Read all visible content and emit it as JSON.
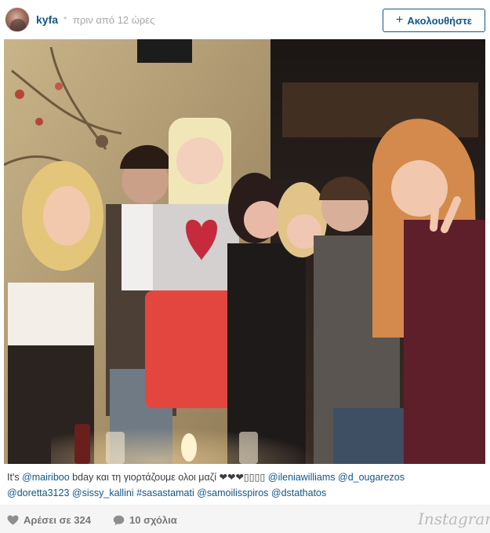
{
  "post": {
    "username": "kyfa",
    "separator": "•",
    "timestamp": "πριν από 12 ώρες",
    "follow_label": "Ακολουθήστε",
    "follow_plus": "+"
  },
  "caption": {
    "text_1": "It's ",
    "mention_1": "@mairiboo",
    "text_2": " bday και τη γιορτάζουμε ολοι μαζί ❤❤❤",
    "boxes": "▯▯▯▯",
    "text_3": " ",
    "mention_2": "@ileniawilliams",
    "mention_3": "@d_ougarezos",
    "mention_4": "@doretta3123",
    "mention_5": "@sissy_kallini",
    "hashtag_1": "#sasastamati",
    "mention_6": "@samoilisspiros",
    "mention_7": "@dstathatos"
  },
  "footer": {
    "likes_label": "Αρέσει σε 324",
    "comments_label": "10 σχόλια",
    "brand": "Instagram"
  },
  "colors": {
    "link": "#125688",
    "footer_bg": "#f5f5f5"
  },
  "icons": {
    "likes": "heart-icon",
    "comments": "speech-bubble-icon"
  }
}
